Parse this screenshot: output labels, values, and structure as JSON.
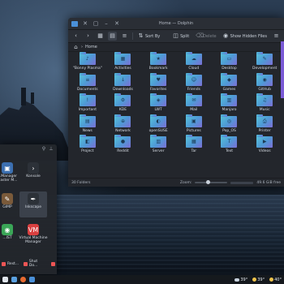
{
  "dolphin": {
    "title": "Home — Dolphin",
    "toolbar": {
      "sort_label": "Sort By",
      "split_label": "Split",
      "delete_label": "Delete",
      "hidden_label": "Show Hidden Files"
    },
    "location": "Home",
    "folders": [
      {
        "label": "\"Bonny Plasma\"",
        "glyph": "♪"
      },
      {
        "label": "Activities",
        "glyph": "▦"
      },
      {
        "label": "Bookmark",
        "glyph": "★"
      },
      {
        "label": "Cloud",
        "glyph": "☁"
      },
      {
        "label": "Desktop",
        "glyph": "▭"
      },
      {
        "label": "Development",
        "glyph": "✎"
      },
      {
        "label": "Documents",
        "glyph": "≡"
      },
      {
        "label": "Downloads",
        "glyph": "↓"
      },
      {
        "label": "Favorites",
        "glyph": "♥"
      },
      {
        "label": "Friends",
        "glyph": "☺"
      },
      {
        "label": "Games",
        "glyph": "◆"
      },
      {
        "label": "GitHub",
        "glyph": "◉"
      },
      {
        "label": "Important",
        "glyph": "!"
      },
      {
        "label": "KDE",
        "glyph": "⚙"
      },
      {
        "label": "LWT",
        "glyph": "◈"
      },
      {
        "label": "Mail",
        "glyph": "✉"
      },
      {
        "label": "Manjaro",
        "glyph": "▥"
      },
      {
        "label": "Music",
        "glyph": "♫"
      },
      {
        "label": "News",
        "glyph": "▤"
      },
      {
        "label": "Network",
        "glyph": "⊕"
      },
      {
        "label": "openSUSE",
        "glyph": "◐"
      },
      {
        "label": "Pictures",
        "glyph": "▣"
      },
      {
        "label": "Pop_OS",
        "glyph": "◎"
      },
      {
        "label": "Printer",
        "glyph": "⎙"
      },
      {
        "label": "Project",
        "glyph": "◧"
      },
      {
        "label": "Reddit",
        "glyph": "●"
      },
      {
        "label": "Server",
        "glyph": "▥"
      },
      {
        "label": "Tar",
        "glyph": "▦"
      },
      {
        "label": "Text",
        "glyph": "T"
      },
      {
        "label": "Videos",
        "glyph": "▶"
      }
    ],
    "status": {
      "count": "30 Folders",
      "zoom_label": "Zoom:",
      "free_space": "49.6 GiB free",
      "free_fraction": 0.35
    }
  },
  "launcher": {
    "apps": [
      {
        "label": "...Manager\nMaster M...",
        "color": "#3b6fb0",
        "glyph": "▣"
      },
      {
        "label": "Konsole",
        "color": "#2c3138",
        "glyph": "›"
      },
      {
        "label": "GIMP",
        "color": "#7a5a3a",
        "glyph": "✎"
      },
      {
        "label": "Inkscape",
        "color": "#2c3138",
        "glyph": "✒"
      },
      {
        "label": "...IST",
        "color": "#3aa657",
        "glyph": "◉"
      },
      {
        "label": "Virtual Machine\nManager",
        "color": "#d94040",
        "glyph": "VM"
      }
    ],
    "actions": [
      {
        "label": "Rest...",
        "color": "#e55"
      },
      {
        "label": "Shut Do...",
        "color": "#e55"
      },
      {
        "label": "",
        "color": "#e55"
      }
    ]
  },
  "taskbar": {
    "temps": [
      "39°",
      "39°",
      "40°"
    ]
  }
}
